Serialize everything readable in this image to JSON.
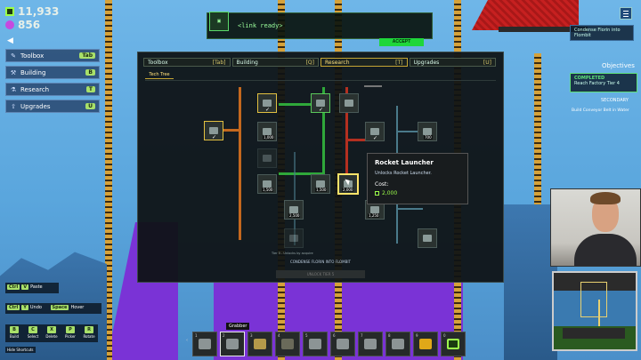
{
  "resources": {
    "credits": "11,933",
    "gems": "856"
  },
  "left_menu": [
    {
      "label": "Toolbox",
      "key": "Tab",
      "icon": "wrench-icon"
    },
    {
      "label": "Building",
      "key": "B",
      "icon": "hammer-icon"
    },
    {
      "label": "Research",
      "key": "T",
      "icon": "flask-icon"
    },
    {
      "label": "Upgrades",
      "key": "U",
      "icon": "arrow-up-icon"
    }
  ],
  "link_bar": {
    "message": "<link ready>",
    "accept_label": "ACCEPT"
  },
  "objectives": {
    "header": "Objectives",
    "top_item": "Condense Florin into Flombit",
    "completed_label": "COMPLETED",
    "completed_text": "Reach Factory Tier 4",
    "secondary_label": "SECONDARY",
    "secondary_text": "Build Conveyor Belt in Water"
  },
  "panel": {
    "tabs": [
      {
        "label": "Toolbox",
        "key": "[Tab]"
      },
      {
        "label": "Building",
        "key": "[Q]"
      },
      {
        "label": "Research",
        "key": "[T]"
      },
      {
        "label": "Upgrades",
        "key": "[U]"
      }
    ],
    "subtab": "Tech Tree",
    "costs": [
      "1,000",
      "700",
      "1,500",
      "1,500",
      "2,000",
      "2,500",
      "1,250"
    ],
    "hint": "Tier 5 - Unlocks by acquire",
    "condense_text": "CONDENSE FLORIN INTO FLOMBIT",
    "button_label": "UNLOCK TIER 5"
  },
  "tooltip": {
    "title": "Rocket Launcher",
    "desc": "Unlocks Rocket Launcher.",
    "cost_label": "Cost:",
    "cost_value": "2,000"
  },
  "keybinds": {
    "row1": [
      {
        "key": "Ctrl"
      },
      {
        "key": "V",
        "label": "Paste"
      }
    ],
    "row2": [
      {
        "key": "Ctrl"
      },
      {
        "key": "Y",
        "label": "Undo"
      },
      {
        "key": "Space",
        "label": "Hover"
      }
    ],
    "row3": [
      {
        "key": "B",
        "label": "Build"
      },
      {
        "key": "C",
        "label": "Select"
      },
      {
        "key": "X",
        "label": "Delete"
      },
      {
        "key": "P",
        "label": "Picker"
      },
      {
        "key": "R",
        "label": "Rotate"
      }
    ],
    "footer": "Hide Shortcuts"
  },
  "hotbar": {
    "tooltip": "Grabber",
    "slots": [
      "1",
      "2",
      "3",
      "4",
      "5",
      "6",
      "7",
      "8",
      "9",
      "0"
    ]
  }
}
